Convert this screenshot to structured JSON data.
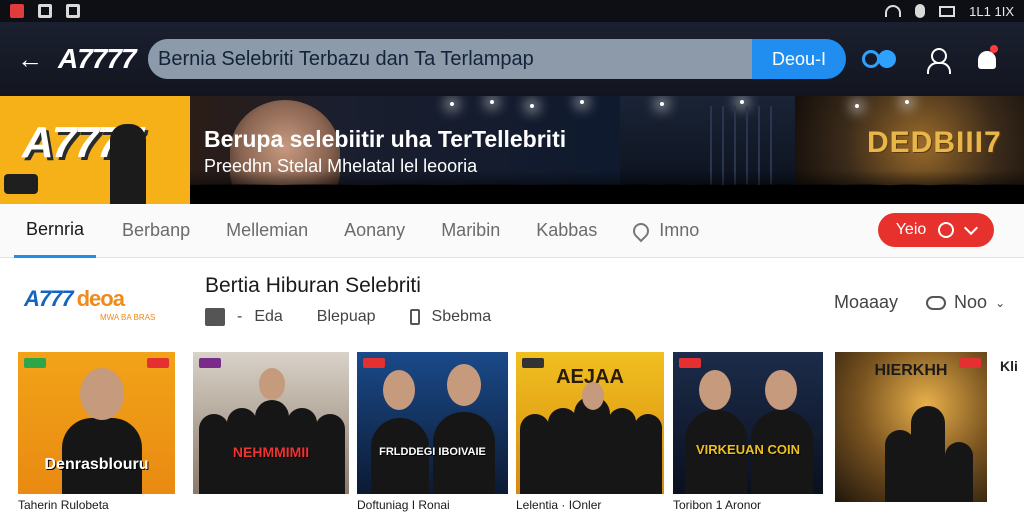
{
  "statusbar": {
    "time": "1L1 1IX"
  },
  "header": {
    "logo": "A7777",
    "search_value": "Bernia Selebriti Terbazu dan Ta Terlampap",
    "search_button": "Deou-I"
  },
  "hero": {
    "left_logo": "A7777",
    "title": "Berupa selebiitir uha TerTellebriti",
    "subtitle": "Preedhn Stelal Mhelatal lel leooria",
    "right_word": "DEDBIII7"
  },
  "tabs": [
    {
      "label": "Bernria"
    },
    {
      "label": "Berbanp"
    },
    {
      "label": "Mellemian"
    },
    {
      "label": "Aonany"
    },
    {
      "label": "Maribin"
    },
    {
      "label": "Kabbas"
    },
    {
      "label": "Imno"
    }
  ],
  "live_button": "Yeio",
  "section": {
    "brand": "A777",
    "brand_accent": "deoa",
    "brand_sub": "MWA BA BRAS",
    "title": "Bertia Hiburan Selebriti",
    "meta": [
      "Eda",
      "Blepuap",
      "Sbebma"
    ],
    "sort_label": "Moaaay",
    "more_label": "Noo"
  },
  "cards": [
    {
      "caption": "Denrasblouru",
      "title": "Taherin Rulobeta"
    },
    {
      "caption": "NEHMMIMII",
      "title": ""
    },
    {
      "caption": "FRLDDEGI IBOIVAIE",
      "title": "Doftuniag I Ronai"
    },
    {
      "caption": "AEJAA",
      "title": "Lelentia · IOnler"
    },
    {
      "caption": "VIRKEUAN COIN",
      "title": "Toribon 1 Aronor"
    },
    {
      "caption": "HIERKHH",
      "title": ""
    }
  ],
  "more_partial": "Kli",
  "colors": {
    "accent": "#1f8ef0",
    "live": "#e7312c",
    "brand_yellow": "#f5b117"
  }
}
